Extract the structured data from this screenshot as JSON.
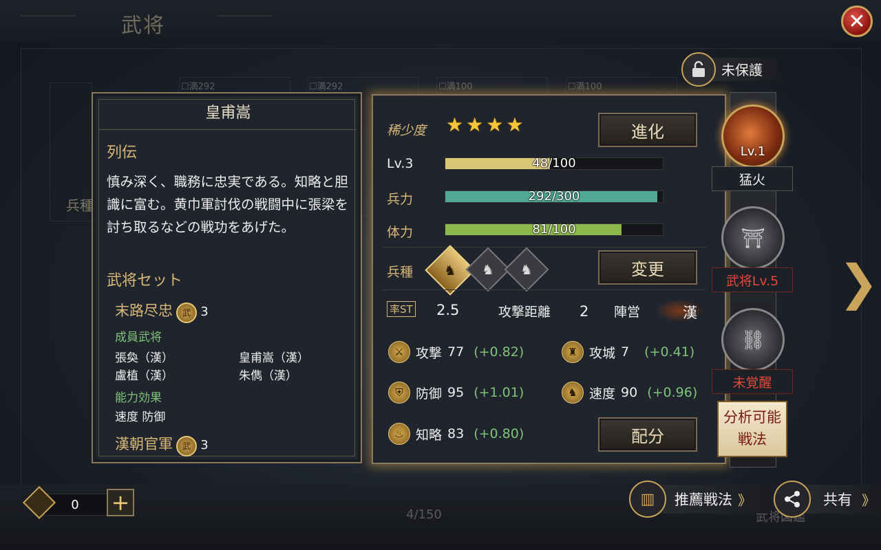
{
  "header": {
    "title": "武将"
  },
  "close_label": "✕",
  "lock": {
    "label": "未保護"
  },
  "background": {
    "card_tags": [
      "☐満292",
      "☐満292",
      "☐満100",
      "☐満100"
    ],
    "side_label": "兵種"
  },
  "bio": {
    "name": "皇甫嵩",
    "section_title": "列伝",
    "text": "慎み深く、職務に忠実である。知略と胆識に富む。黄巾軍討伐の戦闘中に張梁を討ち取るなどの戦功をあげた。",
    "set_title": "武将セット",
    "sets": [
      {
        "name": "末路尽忠",
        "badge": "武",
        "count": "3",
        "members_title": "成員武将",
        "members": [
          "張奐（漢）",
          "皇甫嵩（漢）",
          "盧植（漢）",
          "朱儁（漢）"
        ],
        "effect_title": "能力効果",
        "effect": "速度 防御"
      },
      {
        "name": "漢朝官軍",
        "badge": "武",
        "count": "3"
      }
    ]
  },
  "stats": {
    "rarity_label": "稀少度",
    "rarity": 4,
    "evolve_label": "進化",
    "level": {
      "label": "Lv.3",
      "value": 48,
      "max": 100,
      "text": "48/100",
      "color": "#d9c675"
    },
    "troops": {
      "label": "兵力",
      "value": 292,
      "max": 300,
      "text": "292/300",
      "color": "#4fa995"
    },
    "stamina": {
      "label": "体力",
      "value": 81,
      "max": 100,
      "text": "81/100",
      "color": "#8cb84a"
    },
    "unit_label": "兵種",
    "change_label": "変更",
    "cost_label": "率ST",
    "cost": "2.5",
    "range_label": "攻撃距離",
    "range": "2",
    "camp_label": "陣営",
    "camp": "漢",
    "attrs": [
      {
        "label": "攻撃",
        "value": "77",
        "bonus": "(+0.82)"
      },
      {
        "label": "攻城",
        "value": "7",
        "bonus": "(+0.41)"
      },
      {
        "label": "防御",
        "value": "95",
        "bonus": "(+1.01)"
      },
      {
        "label": "速度",
        "value": "90",
        "bonus": "(+0.96)"
      },
      {
        "label": "知略",
        "value": "83",
        "bonus": "(+0.80)"
      }
    ],
    "allocate_label": "配分"
  },
  "skills": {
    "skill1": {
      "level": "Lv.1",
      "name": "猛火"
    },
    "skill2": {
      "name": "武将Lv.5"
    },
    "skill3": {
      "name": "未覚醒"
    },
    "analyze_line1": "分析可能",
    "analyze_line2": "戦法"
  },
  "bottom": {
    "currency": "0",
    "plus": "+",
    "page": "4/150",
    "recommend_label": "推薦戦法",
    "share_label": "共有",
    "chevrons": "》",
    "encyclopedia_hint": "武将図鑑"
  }
}
